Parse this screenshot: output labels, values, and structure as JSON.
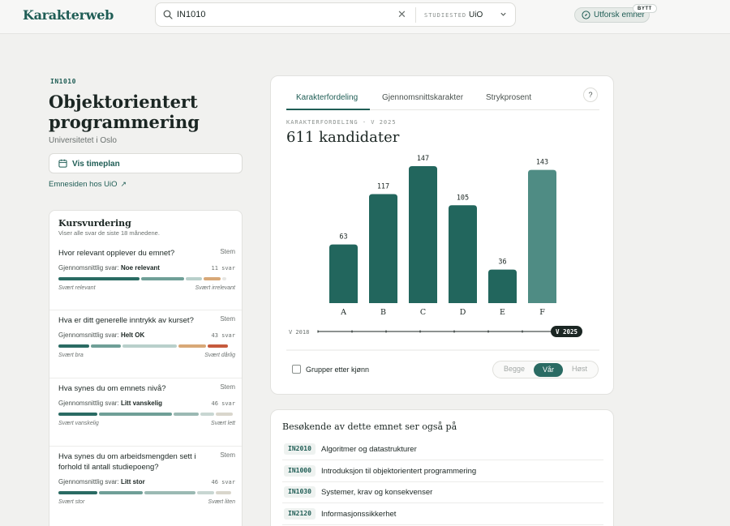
{
  "header": {
    "logo": "Karakterweb",
    "search_value": "IN1010",
    "studiested_label": "STUDIESTED",
    "studiested_value": "UiO",
    "explore_label": "Utforsk emner",
    "badge": "BYTT"
  },
  "course": {
    "code": "IN1010",
    "title": "Objektorientert programmering",
    "university": "Universitetet i Oslo",
    "timeplan_label": "Vis timeplan",
    "emneside_label": "Emnesiden hos UiO",
    "emneside_arrow": "↗"
  },
  "evaluation": {
    "title": "Kursvurdering",
    "subtitle": "Viser alle svar de siste 18 månedene.",
    "avg_prefix": "Gjennomsnittlig svar:",
    "questions": [
      {
        "text": "Hvor relevant opplever du emnet?",
        "stem": "Stem",
        "answer": "Noe relevant",
        "count": "11 svar",
        "left": "Svært relevant",
        "right": "Svært irrelevant",
        "dist": [
          0.48,
          0.25,
          0.1,
          0.1,
          0.02
        ],
        "colors": [
          "#2a6b63",
          "#6f9f97",
          "#b9d0cb",
          "#d8a877",
          "#e7e7e4"
        ]
      },
      {
        "text": "Hva er ditt generelle inntrykk av kurset?",
        "stem": "Stem",
        "answer": "Helt OK",
        "count": "43 svar",
        "left": "Svært bra",
        "right": "Svært dårlig",
        "dist": [
          0.18,
          0.18,
          0.32,
          0.16,
          0.12
        ],
        "colors": [
          "#2a6b63",
          "#6f9f97",
          "#b9d0cb",
          "#d8a877",
          "#c65a3d"
        ]
      },
      {
        "text": "Hva synes du om emnets nivå?",
        "stem": "Stem",
        "answer": "Litt vanskelig",
        "count": "46 svar",
        "left": "Svært vanskelig",
        "right": "Svært lett",
        "dist": [
          0.23,
          0.43,
          0.15,
          0.08,
          0.1
        ],
        "colors": [
          "#2a6b63",
          "#6f9f97",
          "#9bb9b3",
          "#c8d6d2",
          "#d9d6cc"
        ]
      },
      {
        "text": "Hva synes du om arbeidsmengden sett i forhold til antall studiepoeng?",
        "stem": "Stem",
        "answer": "Litt stor",
        "count": "46 svar",
        "left": "Svært stor",
        "right": "Svært liten",
        "dist": [
          0.23,
          0.26,
          0.3,
          0.1,
          0.09
        ],
        "colors": [
          "#2a6b63",
          "#6f9f97",
          "#9bb9b3",
          "#c8d6d2",
          "#d9d6cc"
        ]
      }
    ]
  },
  "tabs": {
    "items": [
      "Karakterfordeling",
      "Gjennomsnittskarakter",
      "Strykprosent"
    ],
    "active": "Karakterfordeling",
    "help": "?"
  },
  "chart_data": {
    "type": "bar",
    "kicker": "KARAKTERFORDELING · V 2025",
    "headline": "611 kandidater",
    "categories": [
      "A",
      "B",
      "C",
      "D",
      "E",
      "F"
    ],
    "values": [
      63,
      117,
      147,
      105,
      36,
      143
    ],
    "colors": {
      "pass": "#22665d",
      "fail": "#4f8c84"
    },
    "ylim": [
      0,
      147
    ],
    "timeline": {
      "start": "V 2018",
      "end": "V 2025",
      "ticks": 8
    }
  },
  "controls": {
    "gender_label": "Grupper etter kjønn",
    "semester_options": [
      "Begge",
      "Vår",
      "Høst"
    ],
    "semester_selected": "Vår"
  },
  "also_visited": {
    "title": "Besøkende av dette emnet ser også på",
    "items": [
      {
        "code": "IN2010",
        "name": "Algoritmer og datastrukturer"
      },
      {
        "code": "IN1000",
        "name": "Introduksjon til objektorientert programmering"
      },
      {
        "code": "IN1030",
        "name": "Systemer, krav og konsekvenser"
      },
      {
        "code": "IN2120",
        "name": "Informasjonssikkerhet"
      }
    ]
  }
}
